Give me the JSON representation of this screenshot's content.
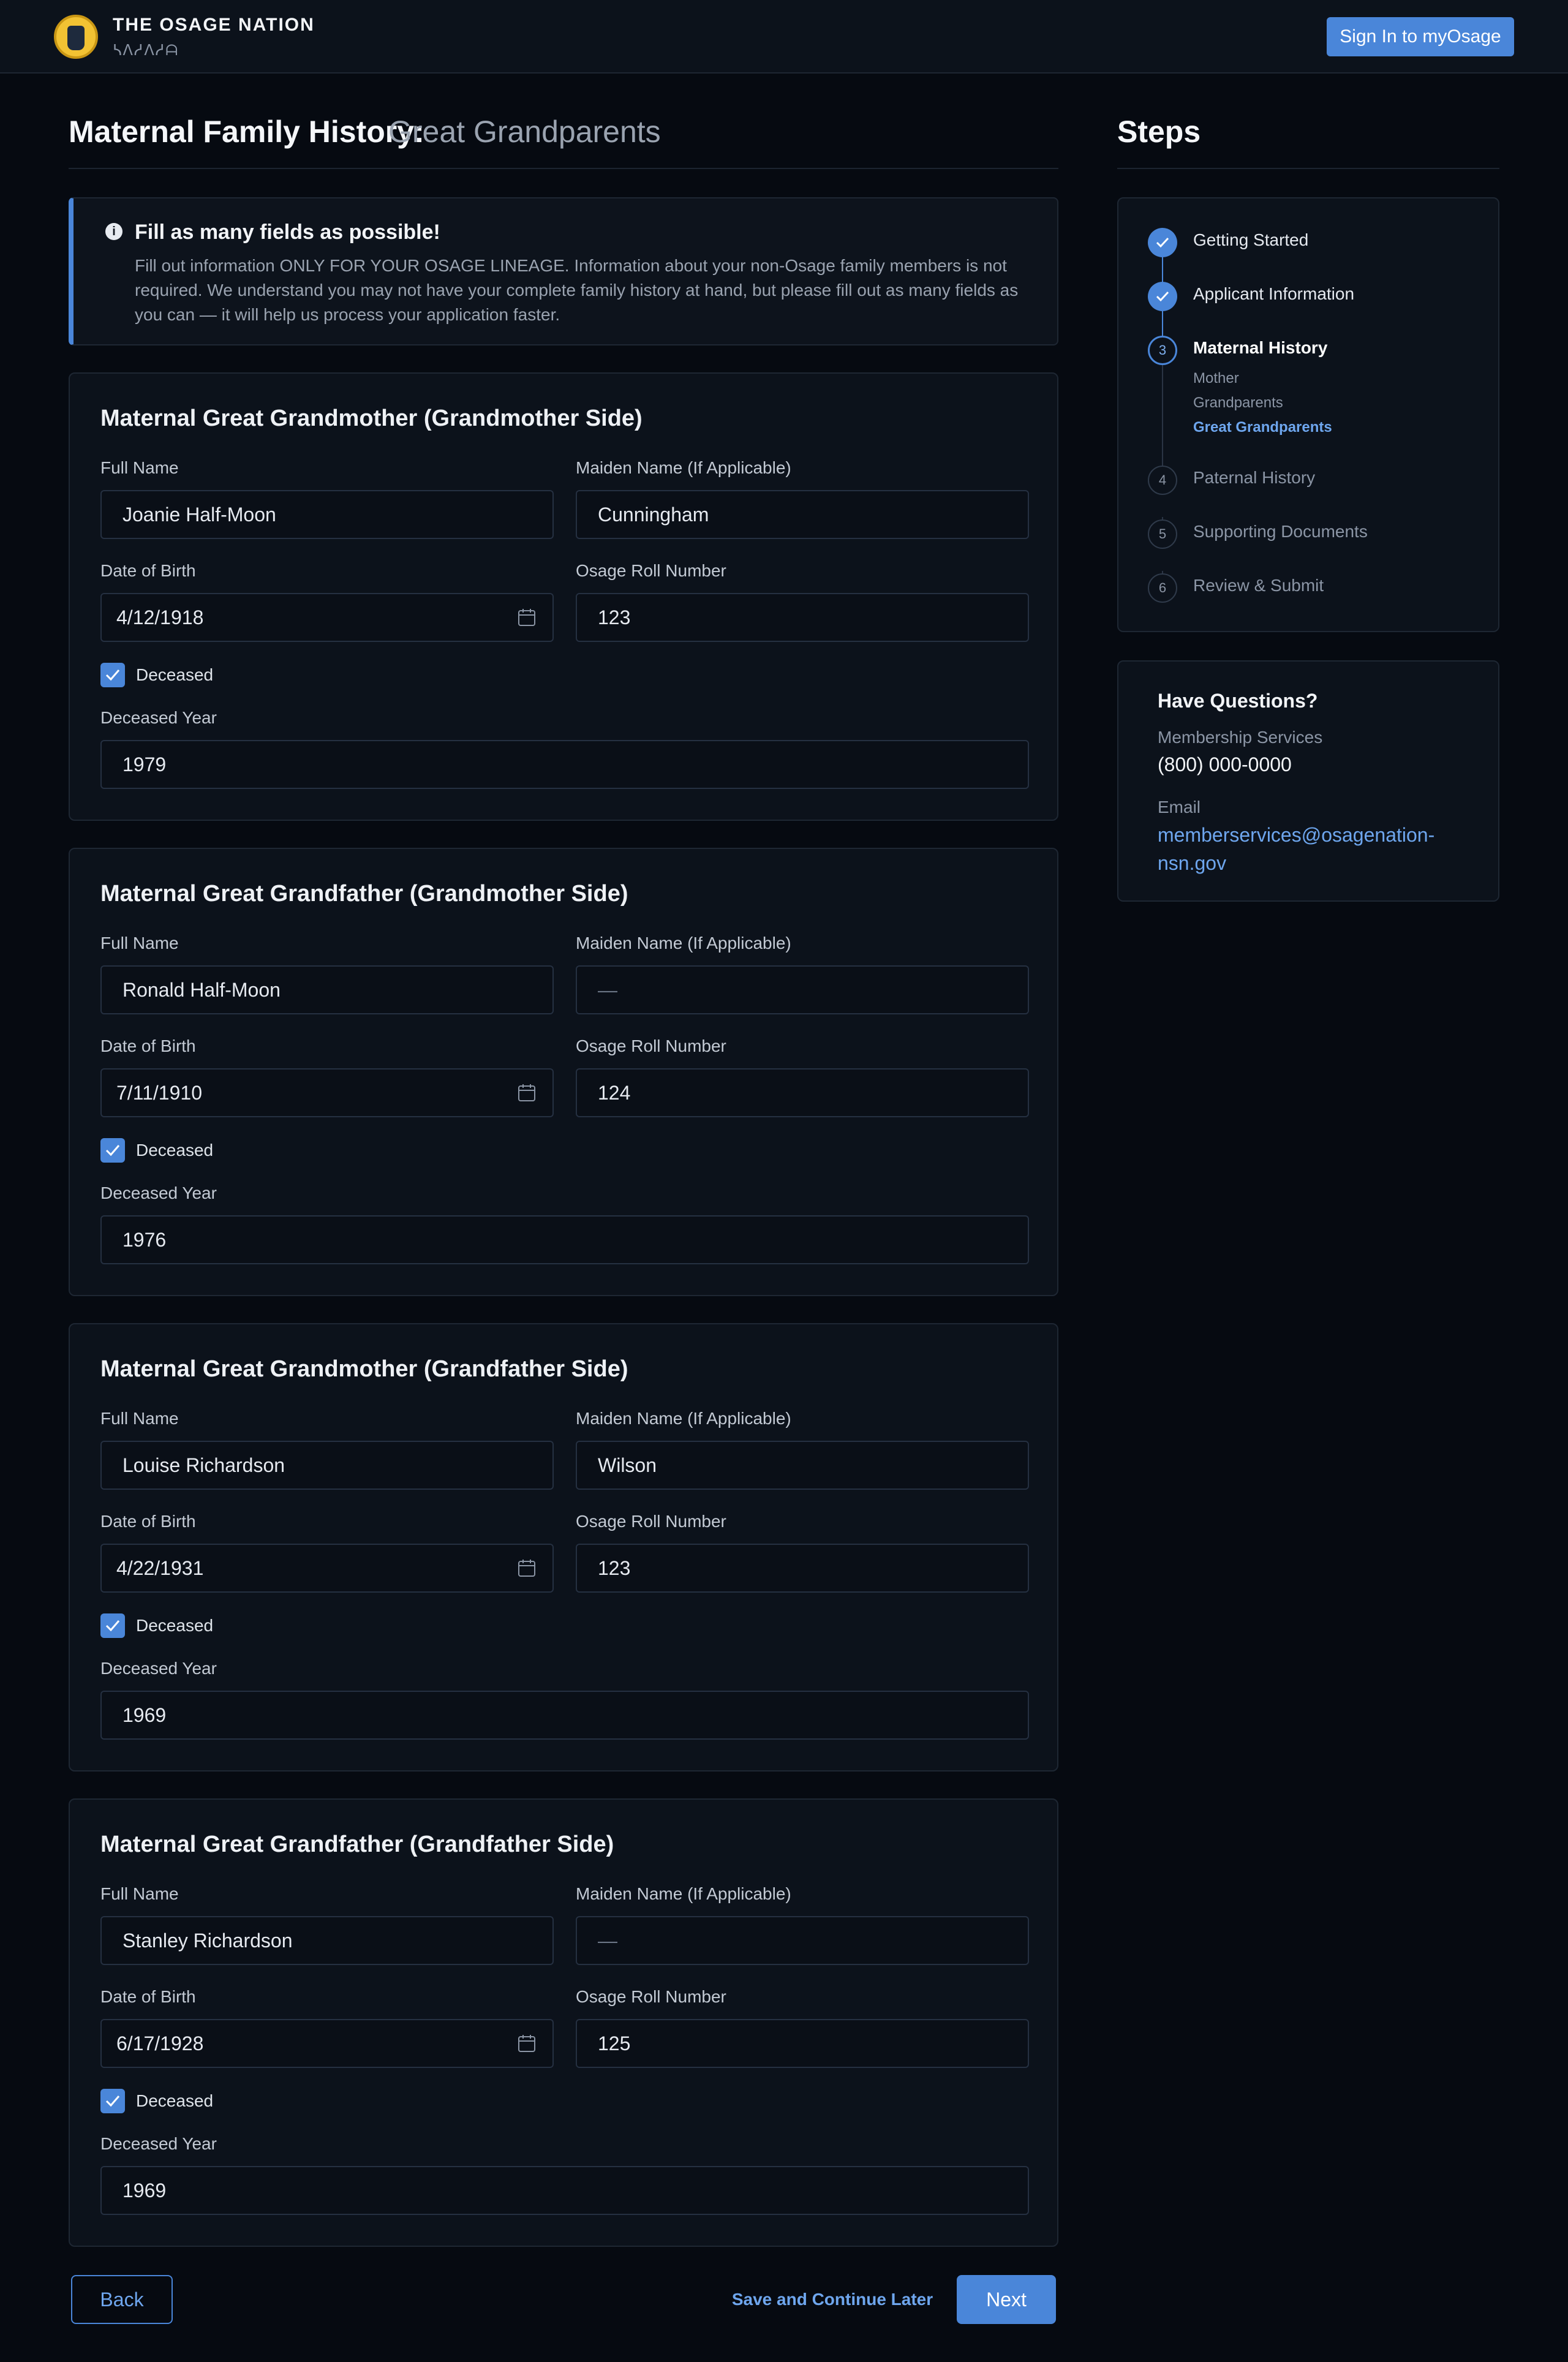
{
  "header": {
    "brand_name": "THE OSAGE NATION",
    "brand_sub": "ᓴᐱᓱᐱᓱᗩ",
    "signin_label": "Sign In to myOsage"
  },
  "page": {
    "title": "Maternal Family History:",
    "subtitle": "Great Grandparents"
  },
  "alert": {
    "icon": "info-icon",
    "title": "Fill as many fields as possible!",
    "body": "Fill out information ONLY FOR YOUR OSAGE LINEAGE. Information about your non-Osage family members is not required. We understand you may not have your complete family history at hand, but please fill out as many fields as you can — it will help us process your application faster."
  },
  "form_labels": {
    "full_name": "Full Name",
    "maiden_name": "Maiden Name (If Applicable)",
    "dob": "Date of Birth",
    "roll": "Osage Roll Number",
    "deceased": "Deceased",
    "deceased_year": "Deceased Year"
  },
  "cards": [
    {
      "title": "Maternal Great Grandmother (Grandmother Side)",
      "full_name": "Joanie Half-Moon",
      "maiden_name": "Cunningham",
      "dob": "4/12/1918",
      "roll": "123",
      "deceased": true,
      "deceased_year": "1979"
    },
    {
      "title": "Maternal Great Grandfather (Grandmother Side)",
      "full_name": "Ronald Half-Moon",
      "maiden_name": "—",
      "dob": "7/11/1910",
      "roll": "124",
      "deceased": true,
      "deceased_year": "1976"
    },
    {
      "title": "Maternal Great Grandmother (Grandfather Side)",
      "full_name": "Louise Richardson",
      "maiden_name": "Wilson",
      "dob": "4/22/1931",
      "roll": "123",
      "deceased": true,
      "deceased_year": "1969"
    },
    {
      "title": "Maternal Great Grandfather (Grandfather Side)",
      "full_name": "Stanley Richardson",
      "maiden_name": "—",
      "dob": "6/17/1928",
      "roll": "125",
      "deceased": true,
      "deceased_year": "1969"
    }
  ],
  "steps": {
    "title": "Steps",
    "items": [
      {
        "num": "1",
        "label": "Getting Started",
        "state": "done"
      },
      {
        "num": "2",
        "label": "Applicant Information",
        "state": "done"
      },
      {
        "num": "3",
        "label": "Maternal History",
        "state": "current"
      },
      {
        "num": "4",
        "label": "Paternal History",
        "state": "todo"
      },
      {
        "num": "5",
        "label": "Supporting Documents",
        "state": "todo"
      },
      {
        "num": "6",
        "label": "Review & Submit",
        "state": "todo"
      }
    ],
    "sub_items": [
      "Mother",
      "Grandparents",
      "Great Grandparents"
    ]
  },
  "questions": {
    "title": "Have Questions?",
    "services_label": "Membership Services",
    "phone": "(800) 000-0000",
    "email_label": "Email",
    "email": "memberservices@osagenation-nsn.gov"
  },
  "footer": {
    "back_label": "Back",
    "save_label": "Save and Continue Later",
    "next_label": "Next"
  },
  "colors": {
    "accent": "#4a86d9",
    "background": "#060a11",
    "card": "#0c121b"
  }
}
